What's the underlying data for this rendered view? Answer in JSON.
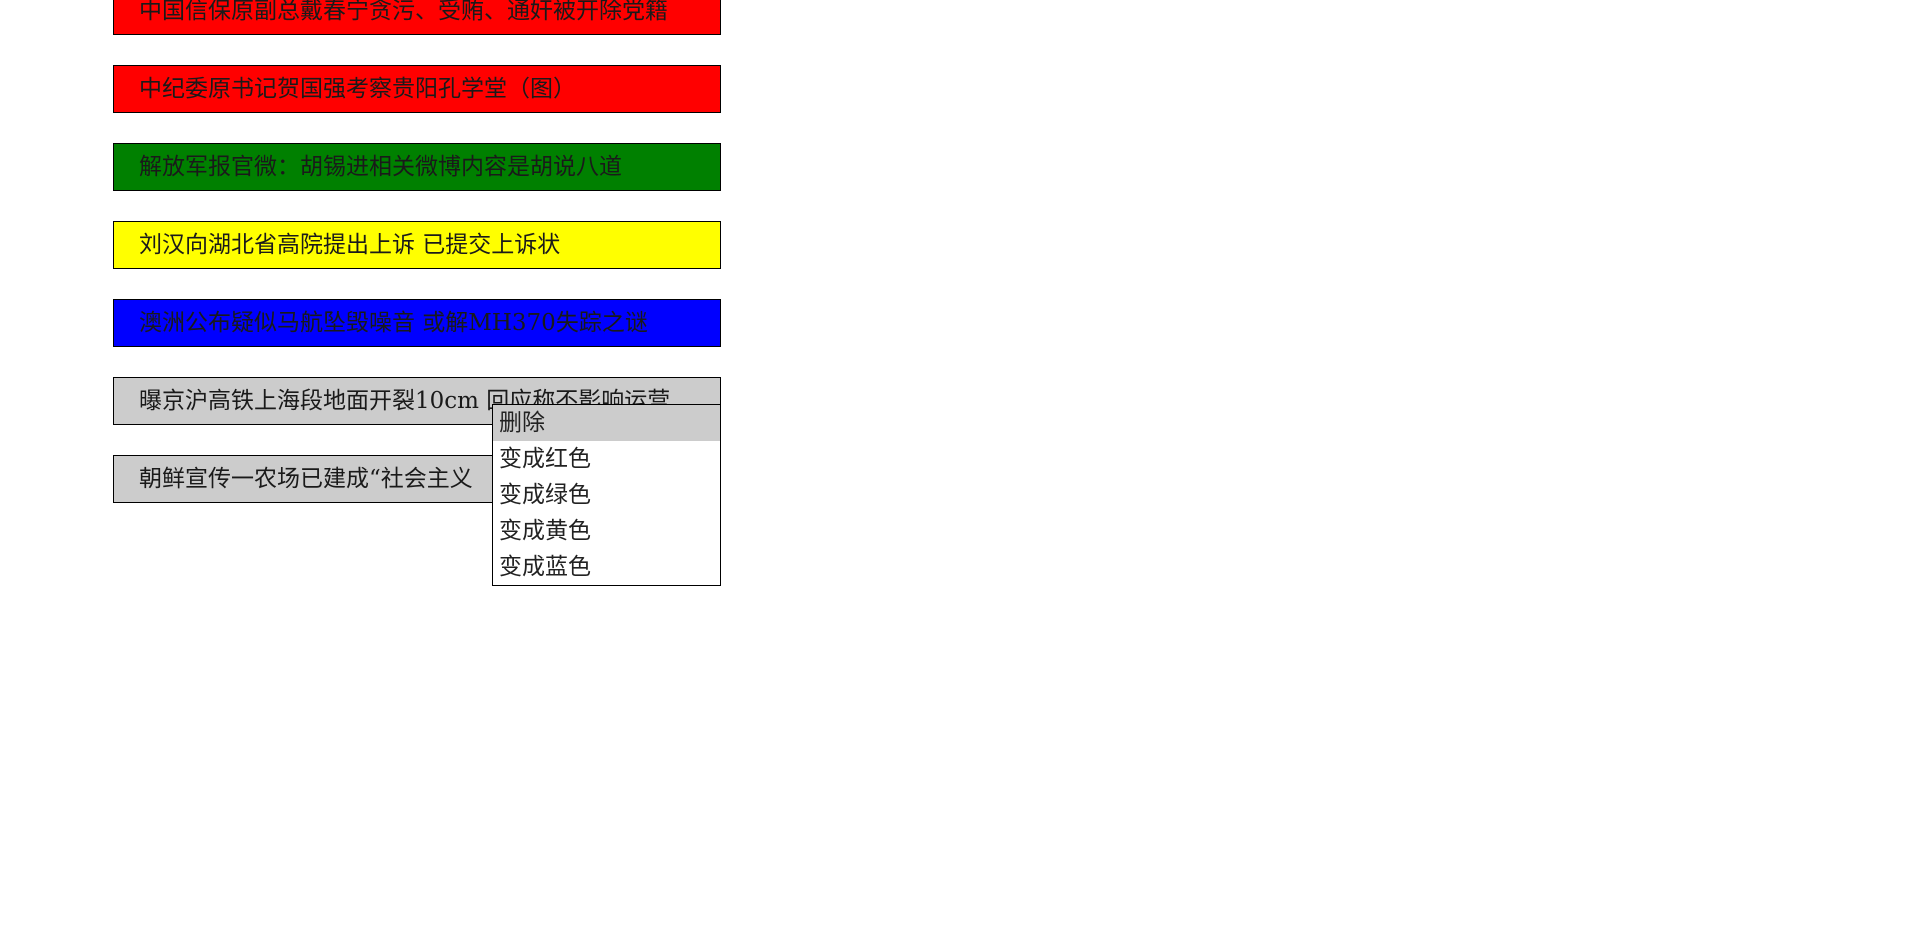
{
  "news_items": [
    {
      "text": "中国信保原副总戴春宁贪污、受贿、通奸被开除党籍",
      "color": "#ff0000"
    },
    {
      "text": "中纪委原书记贺国强考察贵阳孔学堂（图）",
      "color": "#ff0000"
    },
    {
      "text": "解放军报官微：胡锡进相关微博内容是胡说八道",
      "color": "#008000"
    },
    {
      "text": "刘汉向湖北省高院提出上诉 已提交上诉状",
      "color": "#ffff00"
    },
    {
      "text": "澳洲公布疑似马航坠毁噪音 或解MH370失踪之谜",
      "color": "#0000ff"
    },
    {
      "text": "曝京沪高铁上海段地面开裂10cm 回应称不影响运营",
      "color": "#cccccc"
    },
    {
      "text": "朝鲜宣传一农场已建成“社会主义",
      "color": "#cccccc"
    }
  ],
  "context_menu": {
    "items": [
      {
        "label": "删除",
        "highlighted": true
      },
      {
        "label": "变成红色",
        "highlighted": false
      },
      {
        "label": "变成绿色",
        "highlighted": false
      },
      {
        "label": "变成黄色",
        "highlighted": false
      },
      {
        "label": "变成蓝色",
        "highlighted": false
      }
    ],
    "highlight_color": "#cccccc"
  }
}
